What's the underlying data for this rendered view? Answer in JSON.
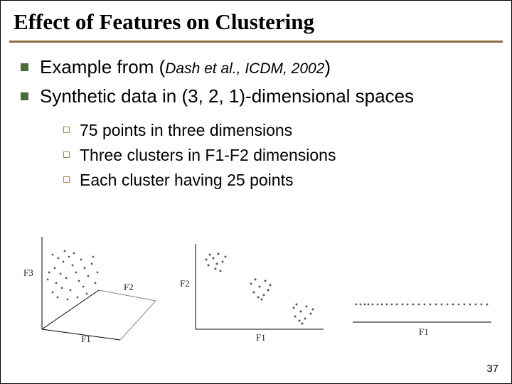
{
  "title": "Effect of Features on Clustering",
  "bullets": {
    "b1_pre": "Example from (",
    "b1_cite": "Dash et al., ICDM, 2002",
    "b1_post": ")",
    "b2": "Synthetic data in (3, 2, 1)-dimensional spaces"
  },
  "subbullets": {
    "s1": "75 points in three dimensions",
    "s2": "Three clusters in F1-F2 dimensions",
    "s3": "Each cluster having 25 points"
  },
  "fig_labels": {
    "f_axis_1": "F1",
    "f_axis_2": "F2",
    "f_axis_3": "F3"
  },
  "page_number": "37",
  "chart_data": [
    {
      "type": "scatter",
      "title": "3D scatter F1-F2-F3",
      "axes": [
        "F1",
        "F2",
        "F3"
      ],
      "note": "75 synthetic points; values not readable from image",
      "series": [
        {
          "name": "points",
          "n": 75,
          "values": null
        }
      ]
    },
    {
      "type": "scatter",
      "title": "2D scatter F1-F2",
      "axes": [
        "F1",
        "F2"
      ],
      "note": "Three visible clusters (~25 pts each); exact values not readable",
      "series": [
        {
          "name": "cluster1",
          "n": 25,
          "values": null
        },
        {
          "name": "cluster2",
          "n": 25,
          "values": null
        },
        {
          "name": "cluster3",
          "n": 25,
          "values": null
        }
      ]
    },
    {
      "type": "scatter",
      "title": "1D scatter F1",
      "axes": [
        "F1"
      ],
      "note": "Points collapsed onto one horizontal line; values not readable",
      "series": [
        {
          "name": "points",
          "n": 75,
          "values": null
        }
      ]
    }
  ]
}
